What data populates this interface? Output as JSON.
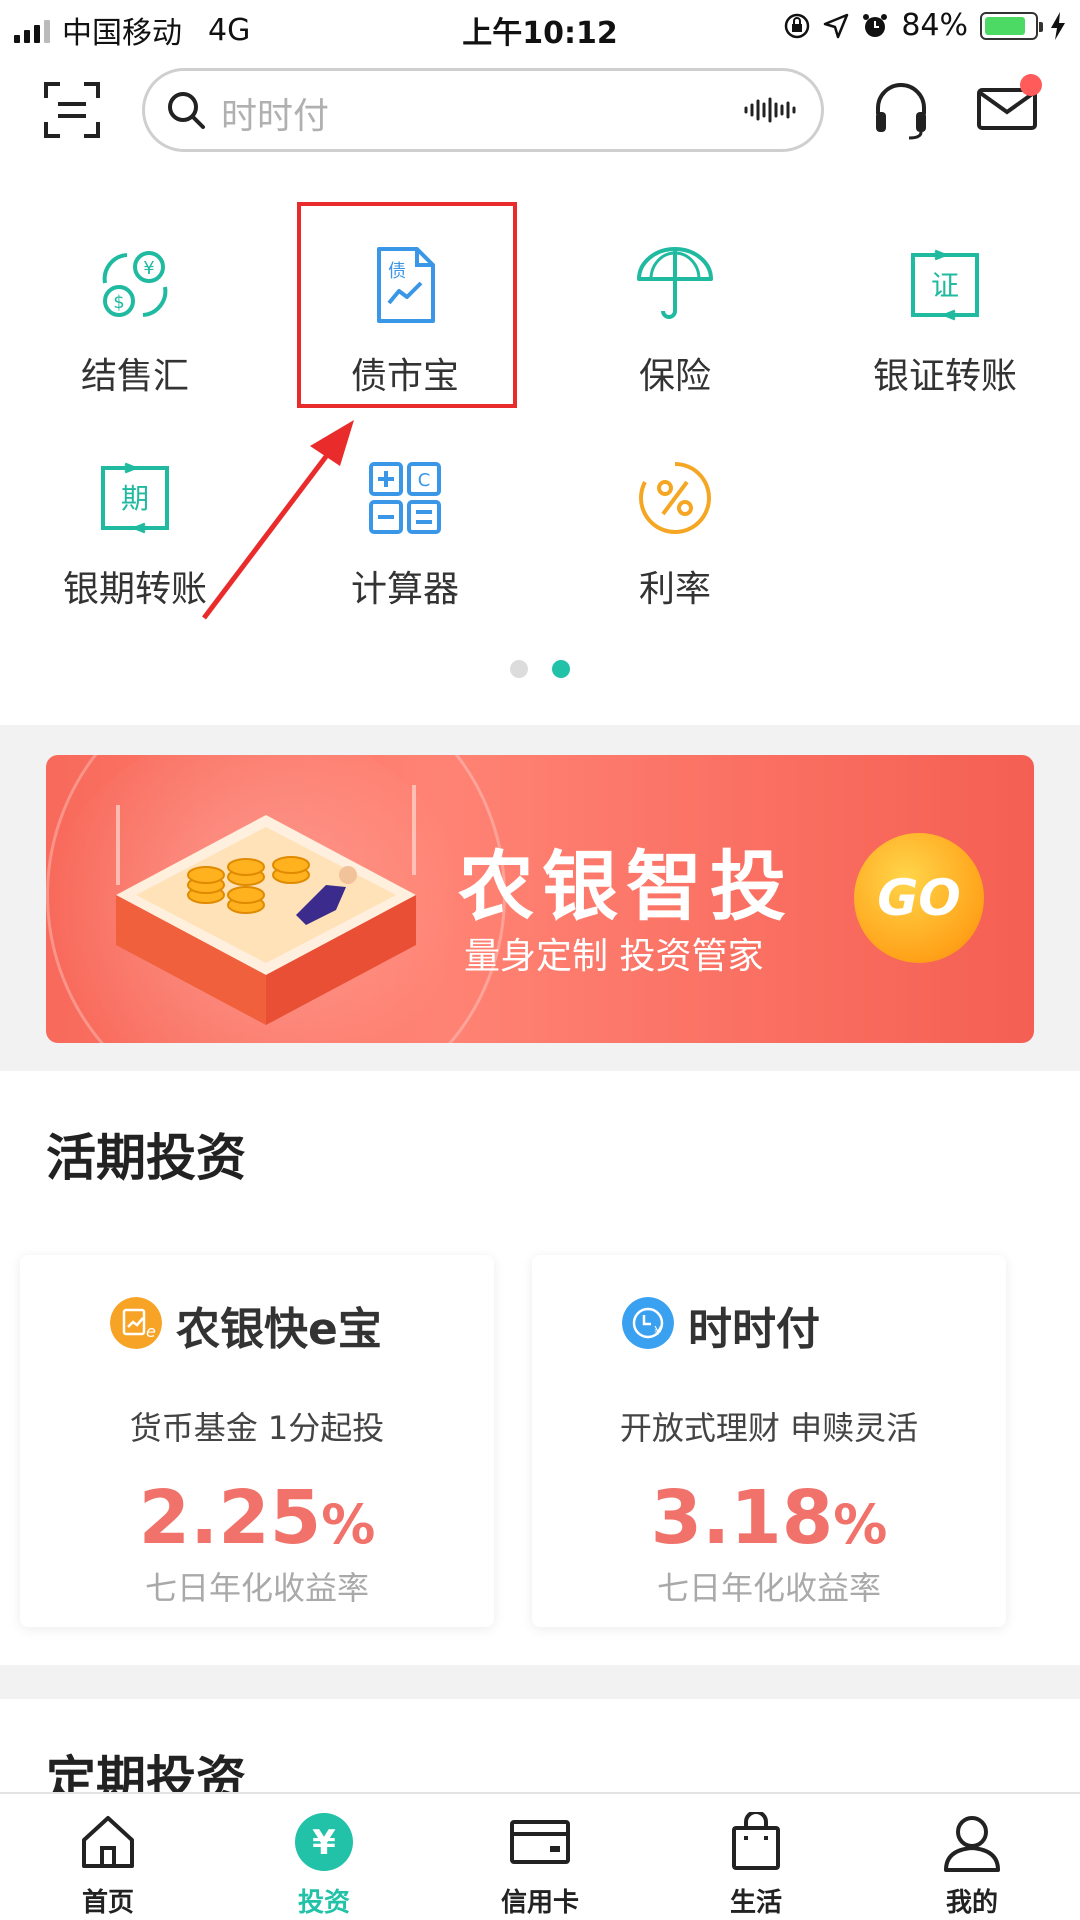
{
  "status_bar": {
    "carrier": "中国移动",
    "network": "4G",
    "time": "上午10:12",
    "battery_percent": "84%",
    "battery_level": 0.84
  },
  "search": {
    "placeholder": "时时付"
  },
  "shortcuts": [
    {
      "label": "结售汇",
      "icon": "exchange-icon"
    },
    {
      "label": "债市宝",
      "icon": "bond-document-icon"
    },
    {
      "label": "保险",
      "icon": "umbrella-icon"
    },
    {
      "label": "银证转账",
      "icon": "securities-transfer-icon"
    },
    {
      "label": "银期转账",
      "icon": "futures-transfer-icon"
    },
    {
      "label": "计算器",
      "icon": "calculator-icon"
    },
    {
      "label": "利率",
      "icon": "percent-icon"
    }
  ],
  "pager": {
    "pages": 2,
    "active": 2
  },
  "banner": {
    "title": "农银智投",
    "subtitle": "量身定制 投资管家",
    "go_label": "GO"
  },
  "sections": {
    "current": "活期投资",
    "fixed": "定期投资"
  },
  "products": [
    {
      "name": "农银快e宝",
      "desc": "货币基金 1分起投",
      "rate": "2.25",
      "rate_unit": "%",
      "rate_label": "七日年化收益率",
      "icon_color": "#f7a325"
    },
    {
      "name": "时时付",
      "desc": "开放式理财 申赎灵活",
      "rate": "3.18",
      "rate_unit": "%",
      "rate_label": "七日年化收益率",
      "icon_color": "#3aa0f0"
    }
  ],
  "tabbar": [
    {
      "label": "首页",
      "icon": "home-icon",
      "active": false
    },
    {
      "label": "投资",
      "icon": "yuan-icon",
      "active": true
    },
    {
      "label": "信用卡",
      "icon": "credit-card-icon",
      "active": false
    },
    {
      "label": "生活",
      "icon": "shopping-bag-icon",
      "active": false
    },
    {
      "label": "我的",
      "icon": "user-icon",
      "active": false
    }
  ],
  "colors": {
    "accent": "#21c2a8",
    "highlight": "#ea2b2b",
    "rate": "#f0726a"
  }
}
